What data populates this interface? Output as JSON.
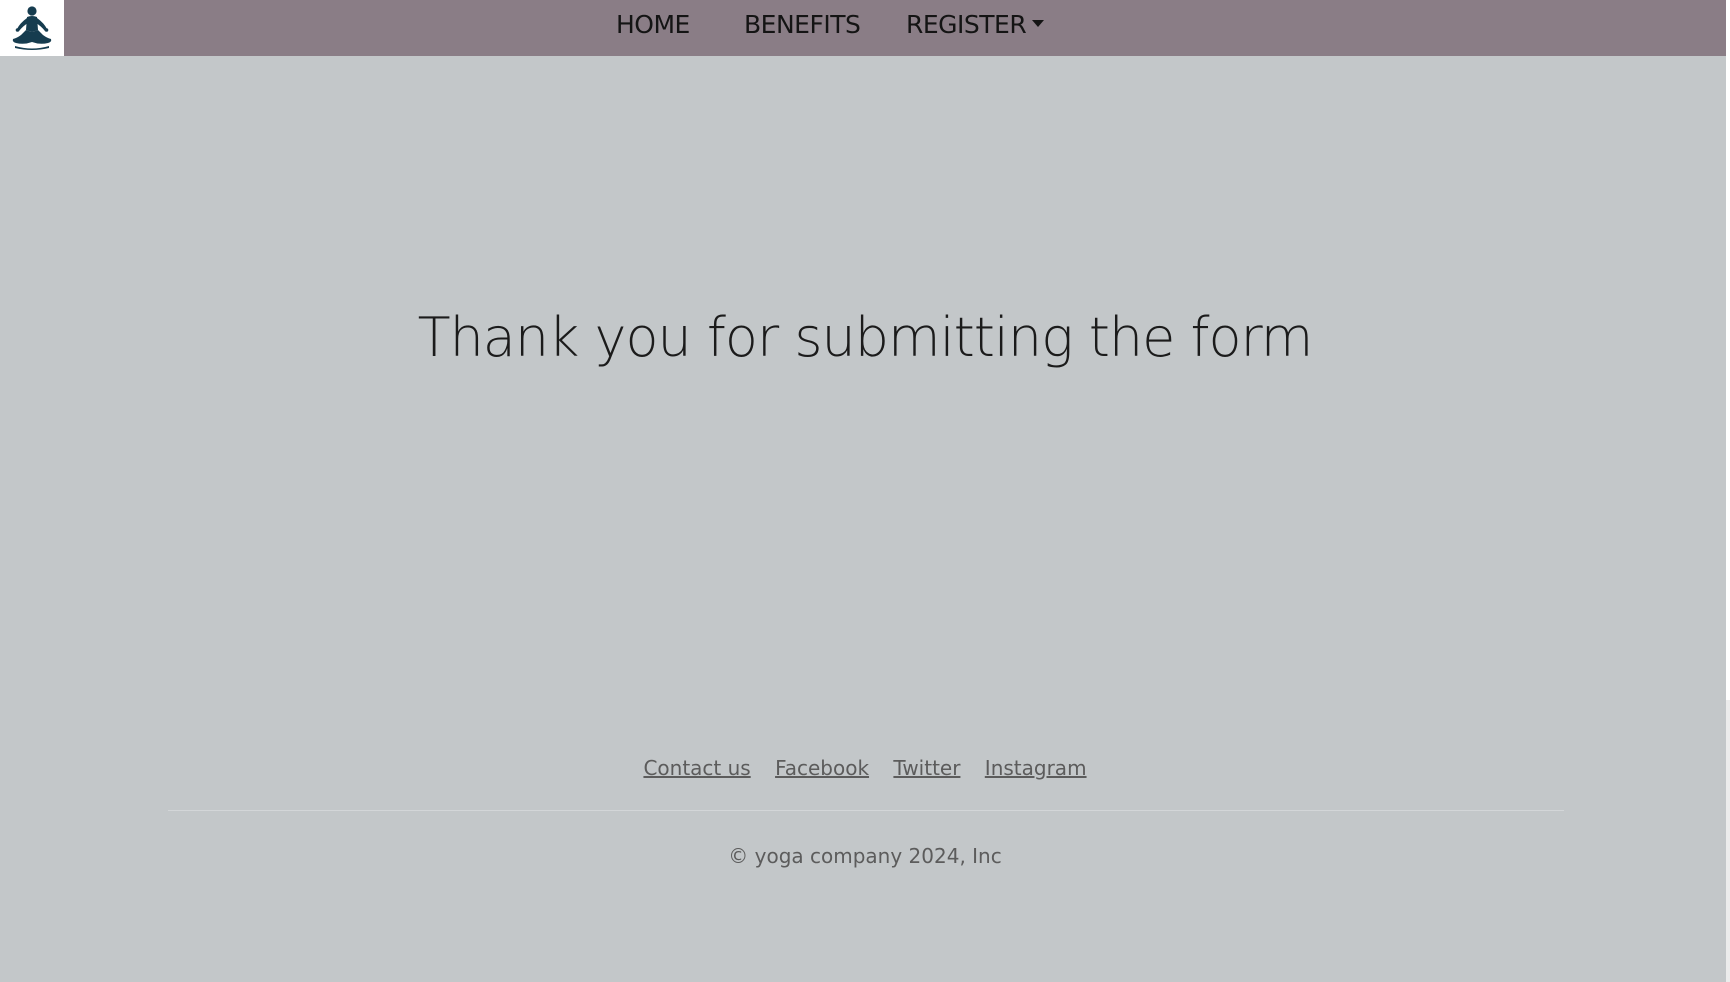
{
  "navbar": {
    "logo_icon": "meditation-pose-icon",
    "items": [
      {
        "label": "HOME"
      },
      {
        "label": "BENEFITS"
      },
      {
        "label": "REGISTER",
        "has_dropdown": true
      }
    ],
    "background_color": "#8a7d86"
  },
  "main": {
    "message": "Thank you for submitting the form"
  },
  "footer": {
    "links": [
      {
        "label": "Contact us"
      },
      {
        "label": "Facebook"
      },
      {
        "label": "Twitter"
      },
      {
        "label": "Instagram"
      }
    ],
    "copyright": "© yoga company 2024, Inc"
  },
  "colors": {
    "page_background": "#c3c7c9",
    "text_muted": "#5c5c5c",
    "logo_icon_color": "#163c4f"
  }
}
